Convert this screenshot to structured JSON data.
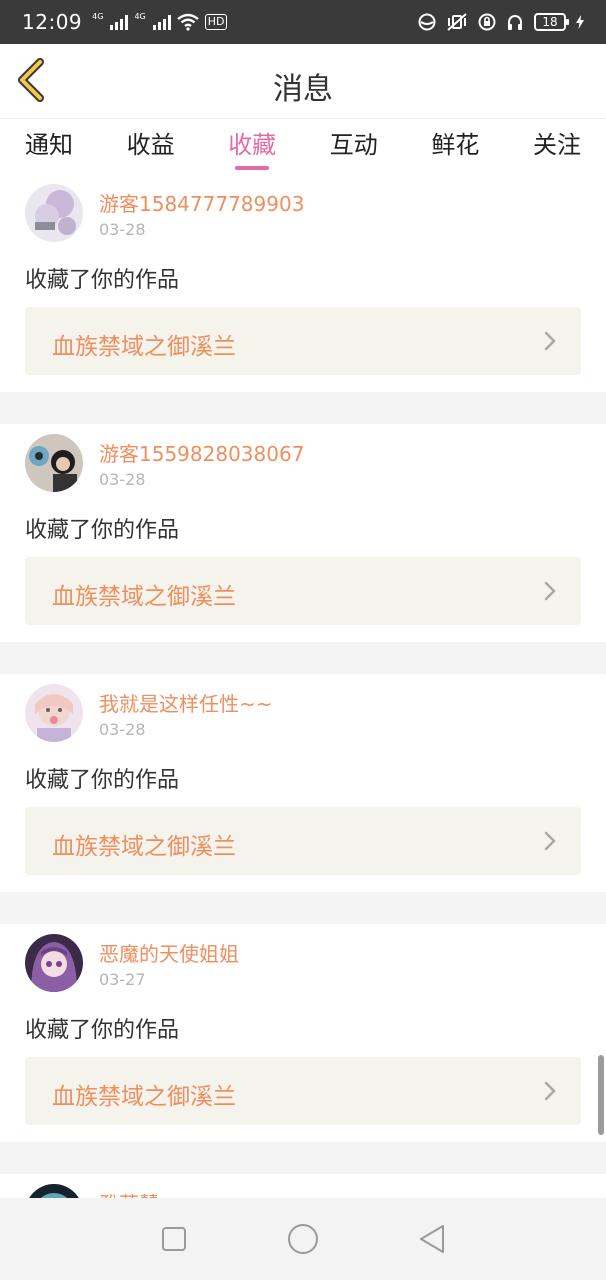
{
  "status_bar": {
    "time": "12:09",
    "network_1": "4G",
    "network_2": "4G",
    "hd": "HD",
    "battery": "18"
  },
  "header": {
    "title": "消息",
    "back_icon": "chevron-left-icon"
  },
  "tabs": [
    {
      "label": "通知",
      "active": false
    },
    {
      "label": "收益",
      "active": false
    },
    {
      "label": "收藏",
      "active": true
    },
    {
      "label": "互动",
      "active": false
    },
    {
      "label": "鲜花",
      "active": false
    },
    {
      "label": "关注",
      "active": false
    }
  ],
  "colors": {
    "accent_pink": "#e46ba3",
    "name_orange": "#ef8f5f",
    "work_bg": "#f5f4ec"
  },
  "messages": [
    {
      "user": "游客1584777789903",
      "date": "03-28",
      "action": "收藏了你的作品",
      "work": "血族禁域之御溪兰"
    },
    {
      "user": "游客1559828038067",
      "date": "03-28",
      "action": "收藏了你的作品",
      "work": "血族禁域之御溪兰"
    },
    {
      "user": "我就是这样任性~~",
      "date": "03-28",
      "action": "收藏了你的作品",
      "work": "血族禁域之御溪兰"
    },
    {
      "user": "恶魔的天使姐姐",
      "date": "03-27",
      "action": "收藏了你的作品",
      "work": "血族禁域之御溪兰"
    },
    {
      "user": "雅薇慧"
    }
  ],
  "nav": {
    "recent": "square-icon",
    "home": "circle-icon",
    "back": "triangle-back-icon"
  }
}
